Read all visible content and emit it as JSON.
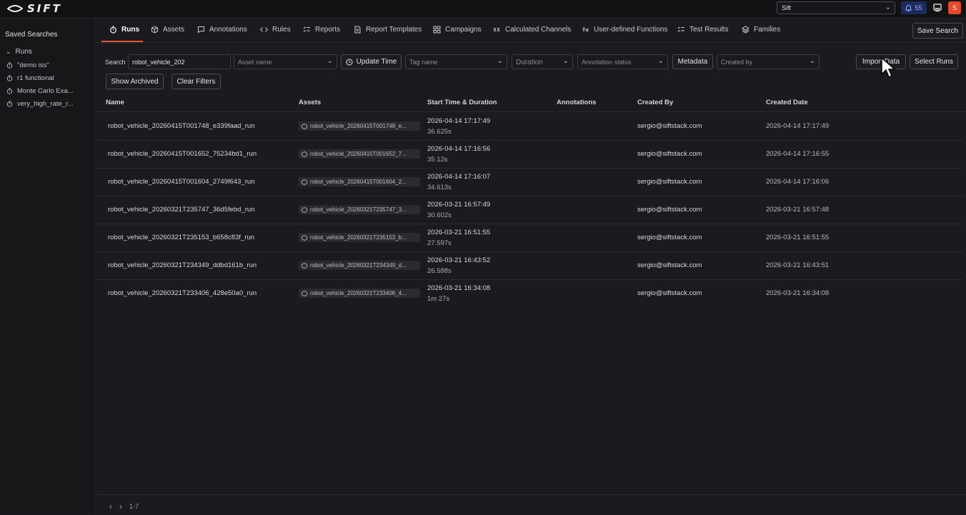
{
  "topbar": {
    "logo_text": "SIFT",
    "org_select": "Sift",
    "notifications_count": "55",
    "avatar_initial": "S"
  },
  "sidebar": {
    "title": "Saved Searches",
    "group": "Runs",
    "items": [
      {
        "label": "\"demo iss\""
      },
      {
        "label": "r1 functional"
      },
      {
        "label": "Monte Carlo Exa..."
      },
      {
        "label": "very_high_rate_r..."
      }
    ]
  },
  "tabs": [
    {
      "label": "Runs",
      "icon": "stopwatch-icon"
    },
    {
      "label": "Assets",
      "icon": "cube-icon"
    },
    {
      "label": "Annotations",
      "icon": "annotation-icon"
    },
    {
      "label": "Rules",
      "icon": "code-icon"
    },
    {
      "label": "Reports",
      "icon": "list-check-icon"
    },
    {
      "label": "Report Templates",
      "icon": "document-icon"
    },
    {
      "label": "Campaigns",
      "icon": "grid-icon"
    },
    {
      "label": "Calculated Channels",
      "icon": "calculated-icon"
    },
    {
      "label": "User-defined Functions",
      "icon": "function-icon"
    },
    {
      "label": "Test Results",
      "icon": "test-list-icon"
    },
    {
      "label": "Families",
      "icon": "layers-icon"
    }
  ],
  "header_actions": {
    "save_search": "Save Search"
  },
  "filters": {
    "search_label": "Search",
    "search_value": "robot_vehicle_202",
    "asset_placeholder": "Asset name",
    "update_time": "Update Time",
    "tag_placeholder": "Tag name",
    "duration_placeholder": "Duration",
    "annotation_placeholder": "Annotation status",
    "metadata": "Metadata",
    "created_by_placeholder": "Created by",
    "import_data": "Import Data",
    "select_runs": "Select Runs",
    "show_archived": "Show Archived",
    "clear_filters": "Clear Filters"
  },
  "table": {
    "columns": [
      "Name",
      "Assets",
      "Start Time & Duration",
      "Annotations",
      "Created By",
      "Created Date"
    ],
    "rows": [
      {
        "name": "robot_vehicle_20260415T001748_e339faad_run",
        "asset": "robot_vehicle_20260415T001748_e...",
        "start": "2026-04-14 17:17:49",
        "duration": "36.625s",
        "created_by": "sergio@siftstack.com",
        "created_date": "2026-04-14 17:17:49"
      },
      {
        "name": "robot_vehicle_20260415T001652_75234bd1_run",
        "asset": "robot_vehicle_20260415T001652_7...",
        "start": "2026-04-14 17:16:56",
        "duration": "35.12s",
        "created_by": "sergio@siftstack.com",
        "created_date": "2026-04-14 17:16:55"
      },
      {
        "name": "robot_vehicle_20260415T001604_2749f643_run",
        "asset": "robot_vehicle_20260415T001604_2...",
        "start": "2026-04-14 17:16:07",
        "duration": "34.613s",
        "created_by": "sergio@siftstack.com",
        "created_date": "2026-04-14 17:16:06"
      },
      {
        "name": "robot_vehicle_20260321T235747_36d5febd_run",
        "asset": "robot_vehicle_20260321T235747_3...",
        "start": "2026-03-21 16:57:49",
        "duration": "30.602s",
        "created_by": "sergio@siftstack.com",
        "created_date": "2026-03-21 16:57:48"
      },
      {
        "name": "robot_vehicle_20260321T235153_b658c83f_run",
        "asset": "robot_vehicle_20260321T235153_b...",
        "start": "2026-03-21 16:51:55",
        "duration": "27.597s",
        "created_by": "sergio@siftstack.com",
        "created_date": "2026-03-21 16:51:55"
      },
      {
        "name": "robot_vehicle_20260321T234349_ddbd161b_run",
        "asset": "robot_vehicle_20260321T234349_d...",
        "start": "2026-03-21 16:43:52",
        "duration": "26.588s",
        "created_by": "sergio@siftstack.com",
        "created_date": "2026-03-21 16:43:51"
      },
      {
        "name": "robot_vehicle_20260321T233406_428e50a0_run",
        "asset": "robot_vehicle_20260321T233406_4...",
        "start": "2026-03-21 16:34:08",
        "duration": "1m 27s",
        "created_by": "sergio@siftstack.com",
        "created_date": "2026-03-21 16:34:08"
      }
    ]
  },
  "footer": {
    "page_range": "1-7"
  },
  "colors": {
    "accent": "#e4572e",
    "background": "#1b1b1f",
    "notification_bg": "#1f2a5c"
  }
}
